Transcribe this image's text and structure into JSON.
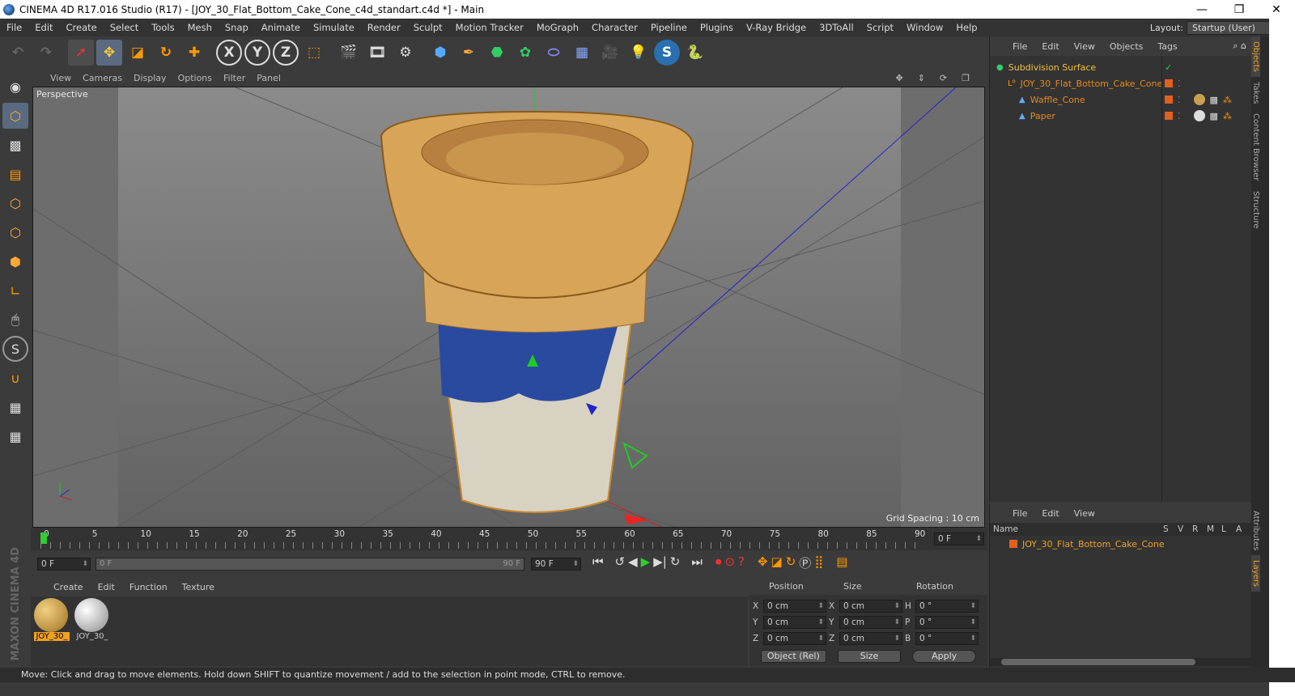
{
  "window": {
    "title": "CINEMA 4D R17.016 Studio (R17) - [JOY_30_Flat_Bottom_Cake_Cone_c4d_standart.c4d *] - Main",
    "controls": [
      "minimize",
      "restore",
      "close"
    ]
  },
  "menubar": {
    "items": [
      "File",
      "Edit",
      "Create",
      "Select",
      "Tools",
      "Mesh",
      "Snap",
      "Animate",
      "Simulate",
      "Render",
      "Sculpt",
      "Motion Tracker",
      "MoGraph",
      "Character",
      "Pipeline",
      "Plugins",
      "V-Ray Bridge",
      "3DToAll",
      "Script",
      "Window",
      "Help"
    ]
  },
  "layout": {
    "label": "Layout:",
    "value": "Startup (User)"
  },
  "toolbar": {
    "icons": [
      "undo-icon",
      "redo-icon",
      "select-live-icon",
      "move-icon",
      "scale-icon",
      "rotate-icon",
      "transform-icon",
      "x-axis-lock-icon",
      "y-axis-lock-icon",
      "z-axis-lock-icon",
      "coordinate-system-icon",
      "render-view-icon",
      "render-picture-viewer-icon",
      "render-settings-icon",
      "cube-primitive-icon",
      "pen-spline-icon",
      "subdivision-nurbs-icon",
      "array-mograph-icon",
      "deformer-icon",
      "floor-icon",
      "camera-icon",
      "light-icon",
      "vray-icon",
      "python-icon"
    ],
    "axis_labels": [
      "X",
      "Y",
      "Z"
    ]
  },
  "left_tools": [
    "make-editable-icon",
    "model-mode-icon",
    "texture-mode-icon",
    "workplane-icon",
    "points-mode-icon",
    "edges-mode-icon",
    "polygons-mode-icon",
    "axis-icon",
    "tweak-icon",
    "snap-icon",
    "magnet-icon",
    "grid-lock-icon",
    "soft-selection-icon"
  ],
  "viewport": {
    "menu": [
      "View",
      "Cameras",
      "Display",
      "Options",
      "Filter",
      "Panel"
    ],
    "label": "Perspective",
    "grid_spacing": "Grid Spacing : 10 cm",
    "nav_icons": [
      "move-view-icon",
      "zoom-view-icon",
      "rotate-view-icon",
      "maximize-view-icon"
    ]
  },
  "timeline": {
    "ticks": [
      "0",
      "5",
      "10",
      "15",
      "20",
      "25",
      "30",
      "35",
      "40",
      "45",
      "50",
      "55",
      "60",
      "65",
      "70",
      "75",
      "80",
      "85",
      "90"
    ],
    "current_frame_display": "0 F",
    "start_frame": "0 F",
    "range_start": "0 F",
    "range_end": "90 F",
    "end_frame": "90 F",
    "playhead_frame": 0
  },
  "materials": {
    "menu": [
      "Create",
      "Edit",
      "Function",
      "Texture"
    ],
    "items": [
      {
        "label": "JOY_30_",
        "selected": true,
        "color": "#c9a050"
      },
      {
        "label": "JOY_30_",
        "selected": false,
        "color": "#e6e6e6"
      }
    ]
  },
  "coordinates": {
    "headers": [
      "Position",
      "Size",
      "Rotation"
    ],
    "rows": [
      {
        "axis": "X",
        "position": "0 cm",
        "size_axis": "X",
        "size": "0 cm",
        "rot_axis": "H",
        "rotation": "0 °"
      },
      {
        "axis": "Y",
        "position": "0 cm",
        "size_axis": "Y",
        "size": "0 cm",
        "rot_axis": "P",
        "rotation": "0 °"
      },
      {
        "axis": "Z",
        "position": "0 cm",
        "size_axis": "Z",
        "size": "0 cm",
        "rot_axis": "B",
        "rotation": "0 °"
      }
    ],
    "mode_select": "Object (Rel)",
    "size_select": "Size",
    "apply_label": "Apply"
  },
  "object_manager": {
    "menu": [
      "File",
      "Edit",
      "View",
      "Objects",
      "Tags"
    ],
    "objects": [
      {
        "name": "Subdivision Surface",
        "indent": 0,
        "color": "#f0c040"
      },
      {
        "name": "JOY_30_Flat_Bottom_Cake_Cone",
        "indent": 1,
        "color": "#e08a20"
      },
      {
        "name": "Waffle_Cone",
        "indent": 2,
        "color": "#e08a20"
      },
      {
        "name": "Paper",
        "indent": 2,
        "color": "#e08a20"
      }
    ]
  },
  "layer_manager": {
    "menu": [
      "File",
      "Edit",
      "View"
    ],
    "columns": [
      "Name",
      "S",
      "V",
      "R",
      "M",
      "L",
      "A"
    ],
    "layers": [
      {
        "name": "JOY_30_Flat_Bottom_Cake_Cone",
        "color": "#e06020"
      }
    ]
  },
  "side_tabs": {
    "top": [
      "Objects",
      "Takes",
      "Content Browser",
      "Structure"
    ],
    "bottom": [
      "Attributes",
      "Layers"
    ]
  },
  "status": "Move: Click and drag to move elements. Hold down SHIFT to quantize movement / add to the selection in point mode, CTRL to remove.",
  "brand": "MAXON CINEMA 4D",
  "colors": {
    "accent": "#e08a20",
    "selection": "#f0c040",
    "play": "#30c030"
  }
}
